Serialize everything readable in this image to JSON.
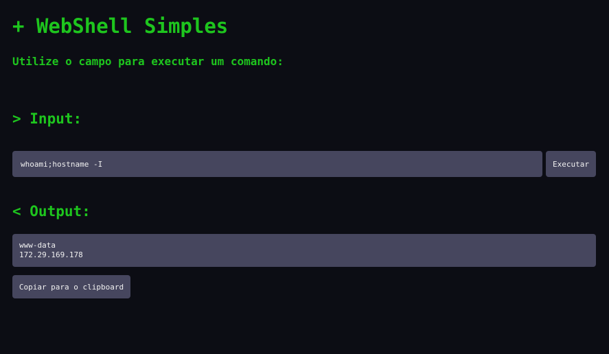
{
  "header": {
    "title": "+ WebShell Simples",
    "subtitle": "Utilize o campo para executar um comando:"
  },
  "input_section": {
    "heading": "> Input:",
    "command_value": "whoami;hostname -I",
    "execute_label": "Executar"
  },
  "output_section": {
    "heading": "< Output:",
    "lines": [
      "www-data",
      "172.29.169.178"
    ],
    "copy_label": "Copiar para o clipboard"
  },
  "colors": {
    "background": "#0c0d14",
    "accent_green": "#1ec51e",
    "field_background": "#46465e",
    "field_text": "#f0f0f0"
  }
}
